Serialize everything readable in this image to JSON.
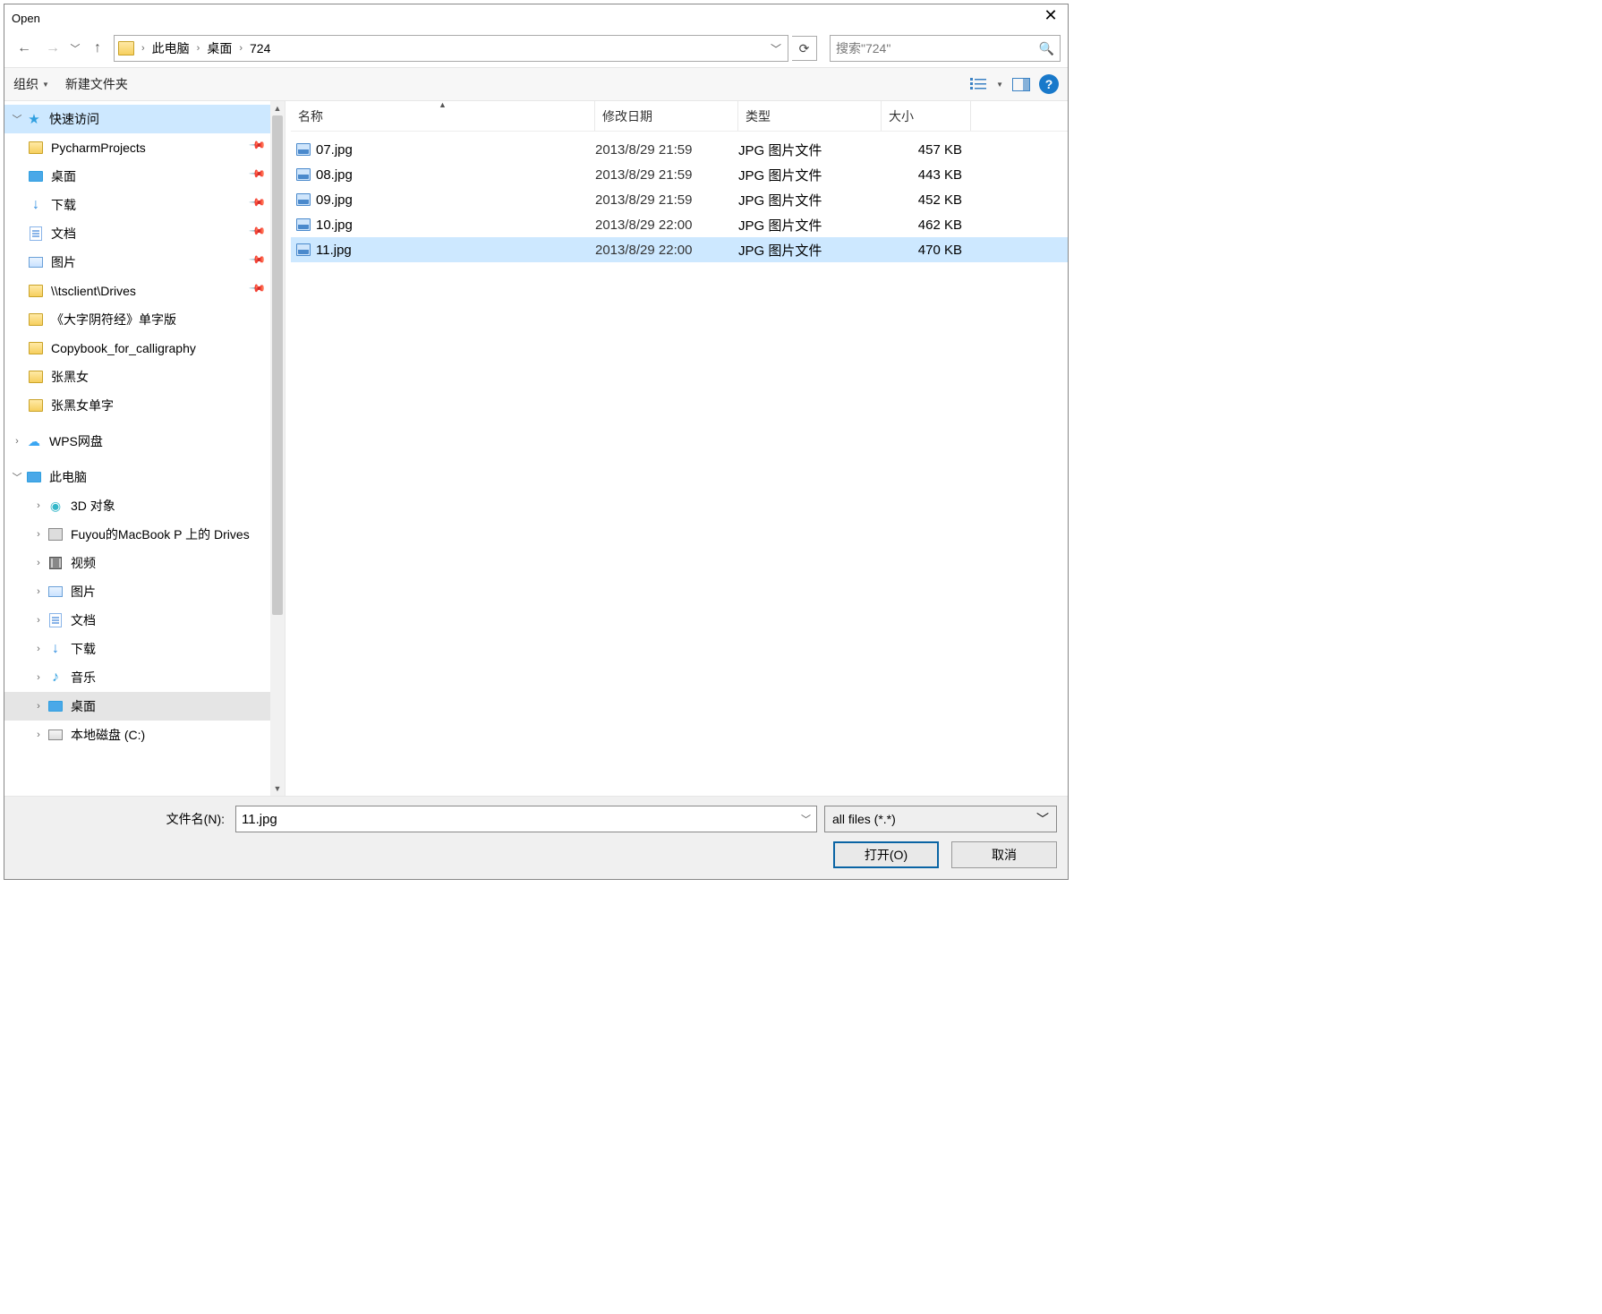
{
  "titlebar": {
    "title": "Open"
  },
  "breadcrumb": {
    "root": "此电脑",
    "mid": "桌面",
    "leaf": "724"
  },
  "search": {
    "placeholder": "搜索\"724\""
  },
  "toolbar": {
    "organize": "组织",
    "newfolder": "新建文件夹"
  },
  "sidebar": {
    "quick_access": "快速访问",
    "pycharm": "PycharmProjects",
    "desktop": "桌面",
    "downloads": "下载",
    "documents": "文档",
    "pictures": "图片",
    "tsclient": "\\\\tsclient\\Drives",
    "book1": "《大字阴符经》单字版",
    "copybook": "Copybook_for_calligraphy",
    "zhang1": "张黑女",
    "zhang2": "张黑女单字",
    "wps": "WPS网盘",
    "thispc": "此电脑",
    "obj3d": "3D 对象",
    "macdrives": "Fuyou的MacBook P 上的 Drives",
    "videos": "视频",
    "pictures2": "图片",
    "documents2": "文档",
    "downloads2": "下载",
    "music": "音乐",
    "desktop2": "桌面",
    "diskc": "本地磁盘 (C:)"
  },
  "columns": {
    "name": "名称",
    "date": "修改日期",
    "type": "类型",
    "size": "大小"
  },
  "files": [
    {
      "name": "07.jpg",
      "date": "2013/8/29 21:59",
      "type": "JPG 图片文件",
      "size": "457 KB",
      "selected": false
    },
    {
      "name": "08.jpg",
      "date": "2013/8/29 21:59",
      "type": "JPG 图片文件",
      "size": "443 KB",
      "selected": false
    },
    {
      "name": "09.jpg",
      "date": "2013/8/29 21:59",
      "type": "JPG 图片文件",
      "size": "452 KB",
      "selected": false
    },
    {
      "name": "10.jpg",
      "date": "2013/8/29 22:00",
      "type": "JPG 图片文件",
      "size": "462 KB",
      "selected": false
    },
    {
      "name": "11.jpg",
      "date": "2013/8/29 22:00",
      "type": "JPG 图片文件",
      "size": "470 KB",
      "selected": true
    }
  ],
  "footer": {
    "filename_label": "文件名(N):",
    "filename_value": "11.jpg",
    "filter": "all files (*.*)",
    "open": "打开(O)",
    "cancel": "取消"
  }
}
